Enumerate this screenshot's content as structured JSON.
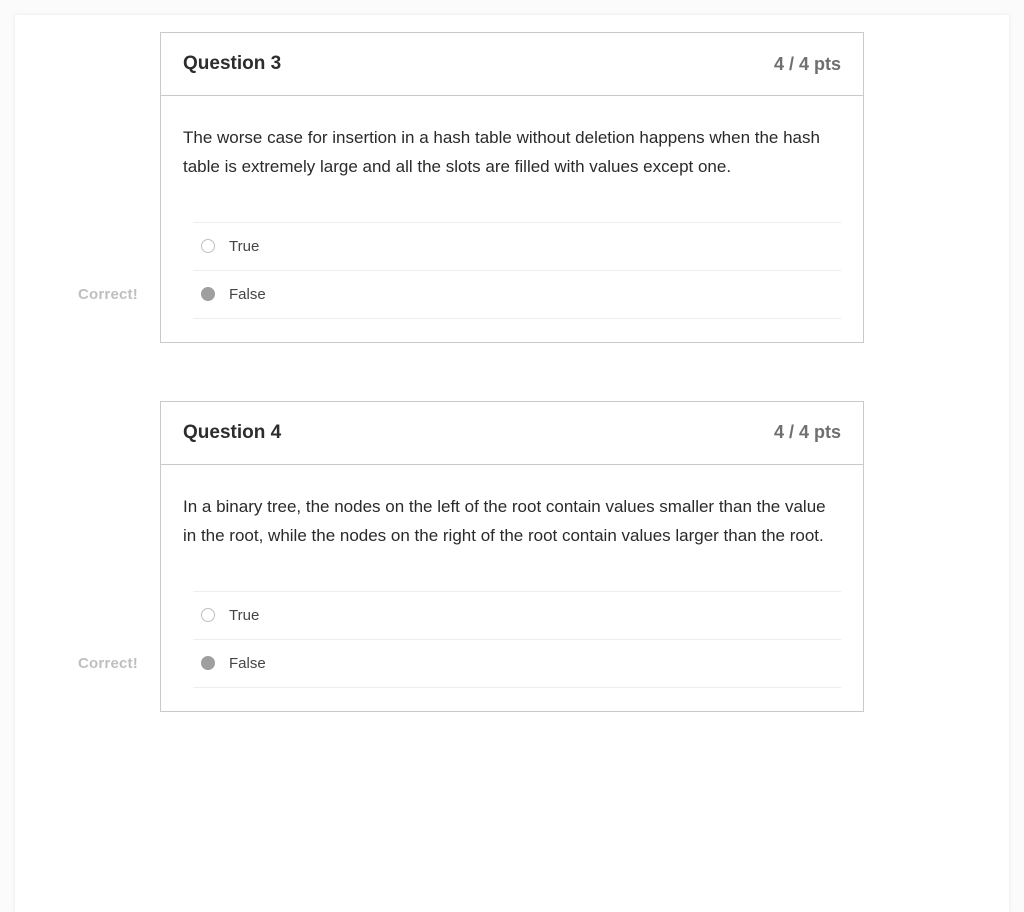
{
  "questions": [
    {
      "title": "Question 3",
      "points": "4 / 4 pts",
      "text": "The worse case for insertion in a hash table without deletion happens when the hash table is extremely large and all the slots are filled with values except one.",
      "answers": [
        {
          "label": "True",
          "selected": false
        },
        {
          "label": "False",
          "selected": true
        }
      ],
      "badge": "Correct!"
    },
    {
      "title": "Question 4",
      "points": "4 / 4 pts",
      "text": "In a binary tree, the nodes on the left of the root contain values smaller than the value in the root, while the nodes on the right of the root contain values larger than the root.",
      "answers": [
        {
          "label": "True",
          "selected": false
        },
        {
          "label": "False",
          "selected": true
        }
      ],
      "badge": "Correct!"
    }
  ]
}
